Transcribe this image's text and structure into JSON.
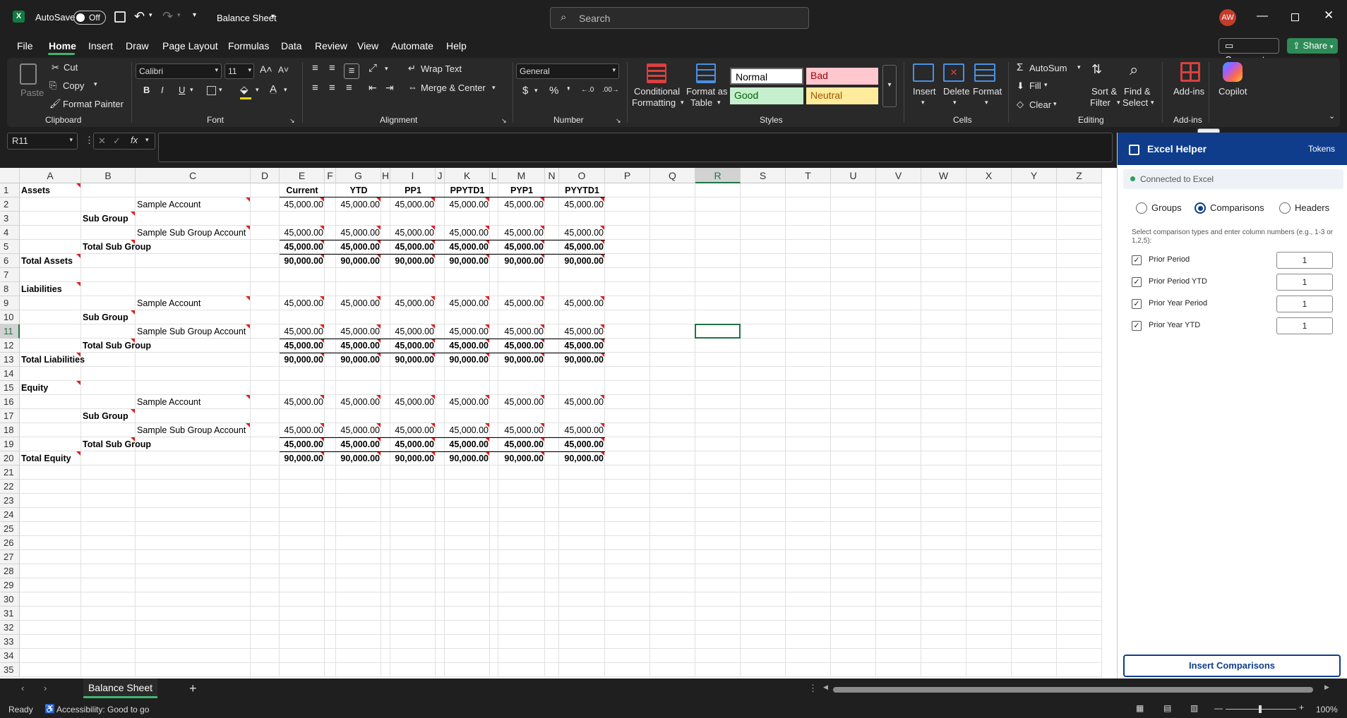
{
  "window": {
    "autosave": "AutoSave",
    "autosave_state": "Off",
    "doc_title": "Balance Sheet",
    "search_placeholder": "Search",
    "user_initials": "AW"
  },
  "menu": {
    "items": [
      "File",
      "Home",
      "Insert",
      "Draw",
      "Page Layout",
      "Formulas",
      "Data",
      "Review",
      "View",
      "Automate",
      "Help"
    ],
    "comments": "Comments",
    "share": "Share"
  },
  "ribbon": {
    "clipboard": {
      "paste": "Paste",
      "cut": "Cut",
      "copy": "Copy",
      "format_painter": "Format Painter",
      "label": "Clipboard"
    },
    "font": {
      "name": "Calibri",
      "size": "11",
      "label": "Font",
      "bold": "B",
      "italic": "I",
      "underline": "U"
    },
    "alignment": {
      "wrap": "Wrap Text",
      "merge": "Merge & Center",
      "label": "Alignment"
    },
    "number": {
      "format": "General",
      "label": "Number"
    },
    "styles": {
      "cond1": "Conditional",
      "cond2": "Formatting",
      "fmt1": "Format as",
      "fmt2": "Table",
      "normal": "Normal",
      "bad": "Bad",
      "good": "Good",
      "neutral": "Neutral",
      "label": "Styles"
    },
    "cells": {
      "insert": "Insert",
      "delete": "Delete",
      "format": "Format",
      "label": "Cells"
    },
    "editing": {
      "autosum": "AutoSum",
      "fill": "Fill",
      "clear": "Clear",
      "sort1": "Sort &",
      "sort2": "Filter",
      "find1": "Find &",
      "find2": "Select",
      "label": "Editing"
    },
    "addins": {
      "name": "Add-ins",
      "label": "Add-ins"
    },
    "copilot": {
      "name": "Copilot"
    }
  },
  "formula_bar": {
    "name_box": "R11",
    "fx": "fx",
    "value": ""
  },
  "grid": {
    "columns": [
      "A",
      "B",
      "C",
      "D",
      "E",
      "F",
      "G",
      "H",
      "I",
      "J",
      "K",
      "L",
      "M",
      "N",
      "O",
      "P",
      "Q",
      "R",
      "S",
      "T",
      "U",
      "V",
      "W",
      "X",
      "Y",
      "Z"
    ],
    "rows": [
      "1",
      "2",
      "3",
      "4",
      "5",
      "6",
      "7",
      "8",
      "9",
      "10",
      "11",
      "12",
      "13",
      "14",
      "15",
      "16",
      "17",
      "18",
      "19",
      "20",
      "21",
      "22",
      "23",
      "24",
      "25",
      "26",
      "27",
      "28",
      "29",
      "30",
      "31",
      "32",
      "33",
      "34",
      "35"
    ],
    "headers": [
      "Current",
      "YTD",
      "PP1",
      "PPYTD1",
      "PYP1",
      "PYYTD1"
    ],
    "cells": [
      {
        "r": 1,
        "a": "Assets",
        "bold": true
      },
      {
        "r": 2,
        "c": "Sample Account",
        "vals": "45,000.00"
      },
      {
        "r": 3,
        "b": "Sub Group",
        "bold": true
      },
      {
        "r": 4,
        "c": "Sample Sub Group Account",
        "vals": "45,000.00"
      },
      {
        "r": 5,
        "b": "Total Sub Group",
        "bold": true,
        "vals": "45,000.00"
      },
      {
        "r": 6,
        "a": "Total Assets",
        "bold": true,
        "vals": "90,000.00"
      },
      {
        "r": 8,
        "a": "Liabilities",
        "bold": true
      },
      {
        "r": 9,
        "c": "Sample Account",
        "vals": "45,000.00"
      },
      {
        "r": 10,
        "b": "Sub Group",
        "bold": true
      },
      {
        "r": 11,
        "c": "Sample Sub Group Account",
        "vals": "45,000.00"
      },
      {
        "r": 12,
        "b": "Total Sub Group",
        "bold": true,
        "vals": "45,000.00"
      },
      {
        "r": 13,
        "a": "Total Liabilities",
        "bold": true,
        "vals": "90,000.00"
      },
      {
        "r": 15,
        "a": "Equity",
        "bold": true
      },
      {
        "r": 16,
        "c": "Sample Account",
        "vals": "45,000.00"
      },
      {
        "r": 17,
        "b": "Sub Group",
        "bold": true
      },
      {
        "r": 18,
        "c": "Sample Sub Group Account",
        "vals": "45,000.00"
      },
      {
        "r": 19,
        "b": "Total Sub Group",
        "bold": true,
        "vals": "45,000.00"
      },
      {
        "r": 20,
        "a": "Total Equity",
        "bold": true,
        "vals": "90,000.00"
      }
    ]
  },
  "sheet_tabs": {
    "active": "Balance Sheet"
  },
  "status": {
    "ready": "Ready",
    "accessibility": "Accessibility: Good to go",
    "zoom": "100%"
  },
  "pane": {
    "title": "Excel Helper",
    "tokens": "Tokens",
    "connection": "Connected to Excel",
    "modes": [
      "Groups",
      "Comparisons",
      "Headers"
    ],
    "selected_mode": "Comparisons",
    "instructions": "Select comparison types and enter column numbers (e.g., 1-3 or 1,2,5):",
    "options": [
      {
        "label": "Prior Period",
        "value": "1"
      },
      {
        "label": "Prior Period YTD",
        "value": "1"
      },
      {
        "label": "Prior Year Period",
        "value": "1"
      },
      {
        "label": "Prior Year YTD",
        "value": "1"
      }
    ],
    "button": "Insert Comparisons"
  },
  "colors": {
    "accent": "#0f3d8c",
    "excel_green": "#107c41",
    "share": "#2e8b57",
    "selection": "#217346"
  }
}
